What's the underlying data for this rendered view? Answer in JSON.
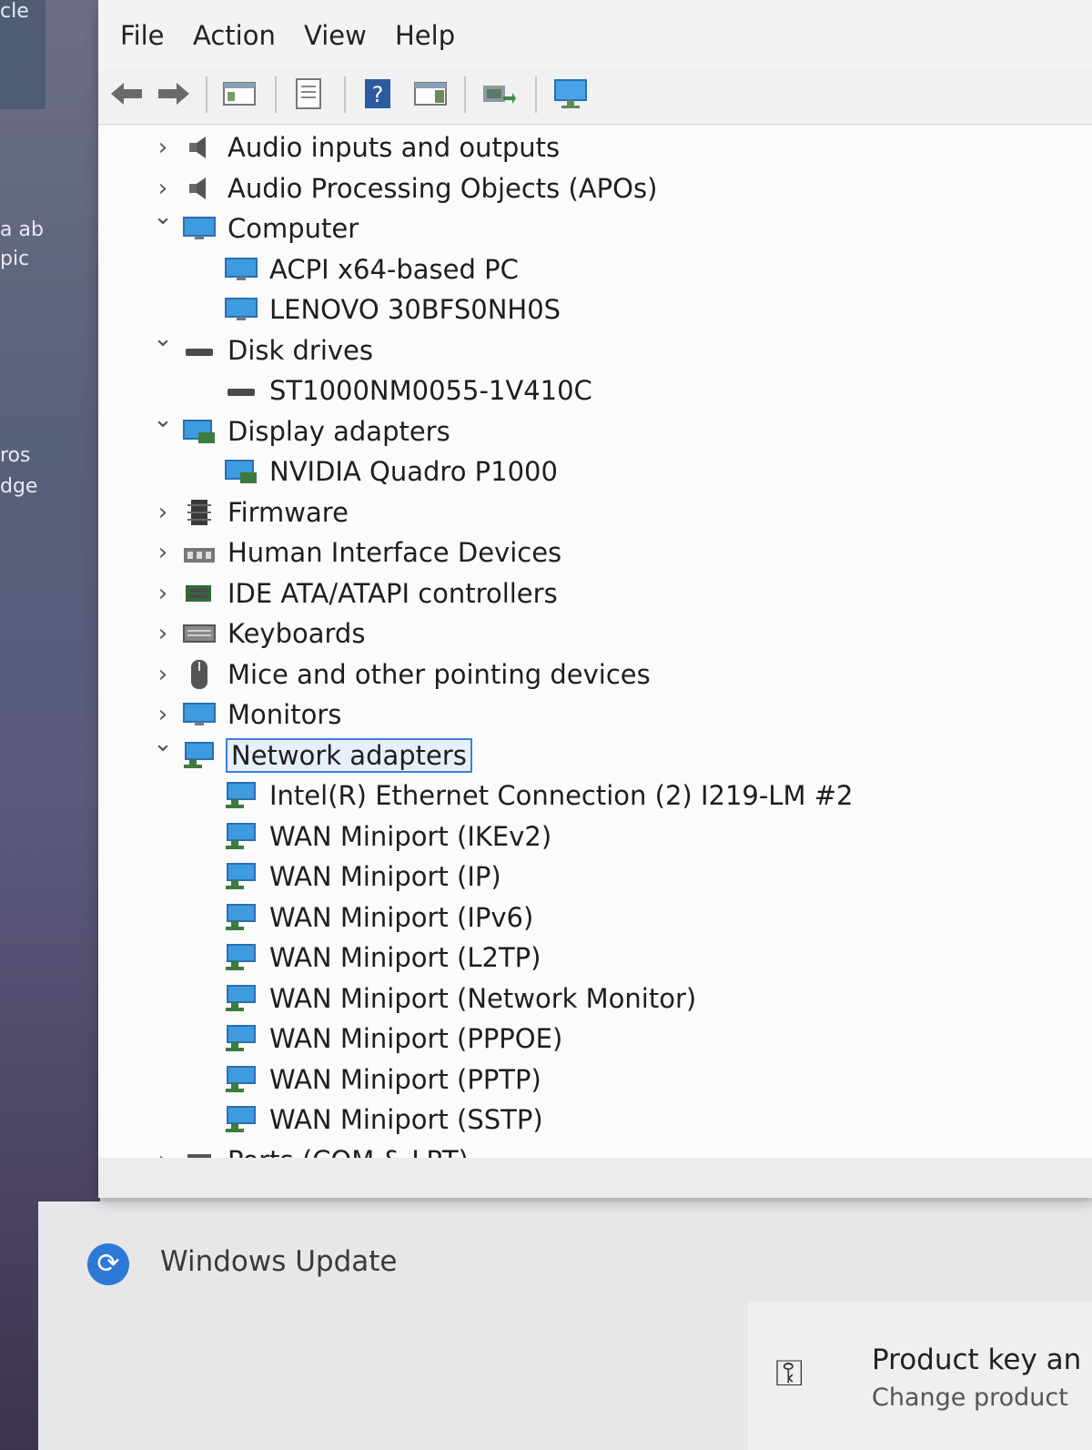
{
  "background_window": {
    "fragments": [
      "cle",
      "a ab",
      "pic",
      "ros",
      "dge"
    ]
  },
  "menu": [
    "File",
    "Action",
    "View",
    "Help"
  ],
  "toolbar": {
    "icons": [
      "back-arrow-icon",
      "forward-arrow-icon",
      "show-hide-console-tree-icon",
      "properties-icon",
      "help-icon",
      "action-pane-icon",
      "scan-hardware-icon",
      "monitor-display-icon"
    ]
  },
  "tree": [
    {
      "label": "Audio inputs and outputs",
      "level": 0,
      "state": "collapsed",
      "icon": "speaker-icon"
    },
    {
      "label": "Audio Processing Objects (APOs)",
      "level": 0,
      "state": "collapsed",
      "icon": "speaker-icon"
    },
    {
      "label": "Computer",
      "level": 0,
      "state": "expanded",
      "icon": "computer-icon"
    },
    {
      "label": "ACPI x64-based PC",
      "level": 1,
      "state": "leaf",
      "icon": "computer-icon"
    },
    {
      "label": "LENOVO 30BFS0NH0S",
      "level": 1,
      "state": "leaf",
      "icon": "computer-icon"
    },
    {
      "label": "Disk drives",
      "level": 0,
      "state": "expanded",
      "icon": "disk-drive-icon"
    },
    {
      "label": "ST1000NM0055-1V410C",
      "level": 1,
      "state": "leaf",
      "icon": "disk-drive-icon"
    },
    {
      "label": "Display adapters",
      "level": 0,
      "state": "expanded",
      "icon": "display-adapter-icon"
    },
    {
      "label": "NVIDIA Quadro P1000",
      "level": 1,
      "state": "leaf",
      "icon": "display-adapter-icon"
    },
    {
      "label": "Firmware",
      "level": 0,
      "state": "collapsed",
      "icon": "firmware-chip-icon"
    },
    {
      "label": "Human Interface Devices",
      "level": 0,
      "state": "collapsed",
      "icon": "hid-icon"
    },
    {
      "label": "IDE ATA/ATAPI controllers",
      "level": 0,
      "state": "collapsed",
      "icon": "ide-controller-icon"
    },
    {
      "label": "Keyboards",
      "level": 0,
      "state": "collapsed",
      "icon": "keyboard-icon"
    },
    {
      "label": "Mice and other pointing devices",
      "level": 0,
      "state": "collapsed",
      "icon": "mouse-icon"
    },
    {
      "label": "Monitors",
      "level": 0,
      "state": "collapsed",
      "icon": "monitor-icon"
    },
    {
      "label": "Network adapters",
      "level": 0,
      "state": "expanded",
      "icon": "network-adapter-icon",
      "selected": true
    },
    {
      "label": "Intel(R) Ethernet Connection (2) I219-LM #2",
      "level": 1,
      "state": "leaf",
      "icon": "network-adapter-icon"
    },
    {
      "label": "WAN Miniport (IKEv2)",
      "level": 1,
      "state": "leaf",
      "icon": "network-adapter-icon"
    },
    {
      "label": "WAN Miniport (IP)",
      "level": 1,
      "state": "leaf",
      "icon": "network-adapter-icon"
    },
    {
      "label": "WAN Miniport (IPv6)",
      "level": 1,
      "state": "leaf",
      "icon": "network-adapter-icon"
    },
    {
      "label": "WAN Miniport (L2TP)",
      "level": 1,
      "state": "leaf",
      "icon": "network-adapter-icon"
    },
    {
      "label": "WAN Miniport (Network Monitor)",
      "level": 1,
      "state": "leaf",
      "icon": "network-adapter-icon"
    },
    {
      "label": "WAN Miniport (PPPOE)",
      "level": 1,
      "state": "leaf",
      "icon": "network-adapter-icon"
    },
    {
      "label": "WAN Miniport (PPTP)",
      "level": 1,
      "state": "leaf",
      "icon": "network-adapter-icon"
    },
    {
      "label": "WAN Miniport (SSTP)",
      "level": 1,
      "state": "leaf",
      "icon": "network-adapter-icon"
    },
    {
      "label": "Ports (COM & LPT)",
      "level": 0,
      "state": "collapsed",
      "icon": "port-icon"
    }
  ],
  "settings": {
    "windows_update_label": "Windows Update",
    "product_key_title": "Product key an",
    "product_key_subtitle": "Change product"
  }
}
